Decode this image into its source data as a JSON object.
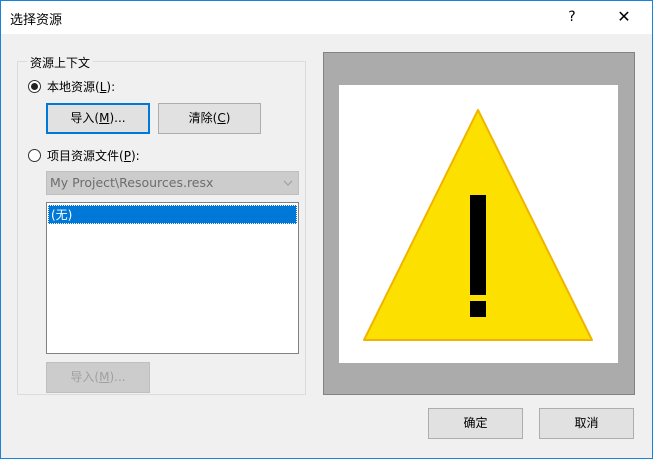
{
  "dialog": {
    "title": "选择资源",
    "help_symbol": "?",
    "close_symbol": "✕"
  },
  "resource_context": {
    "legend": "资源上下文",
    "local": {
      "label": "本地资源",
      "hotkey": "L",
      "suffix": ":",
      "checked": true
    },
    "import_button": {
      "label": "导入",
      "hotkey": "M",
      "suffix": "..."
    },
    "clear_button": {
      "label": "清除",
      "hotkey": "C"
    },
    "project": {
      "label": "项目资源文件",
      "hotkey": "P",
      "suffix": ":",
      "checked": false
    },
    "project_file_select": {
      "value": "My Project\\Resources.resx"
    },
    "resource_list": {
      "items": [
        "(无)"
      ]
    },
    "project_import_button": {
      "label": "导入",
      "hotkey": "M",
      "suffix": "..."
    }
  },
  "footer": {
    "ok_label": "确定",
    "cancel_label": "取消"
  },
  "colors": {
    "warning_fill": "#fce100",
    "warning_stroke": "#f0b400",
    "selection": "#0078d7"
  },
  "icons": {
    "preview": "warning-triangle-icon"
  }
}
